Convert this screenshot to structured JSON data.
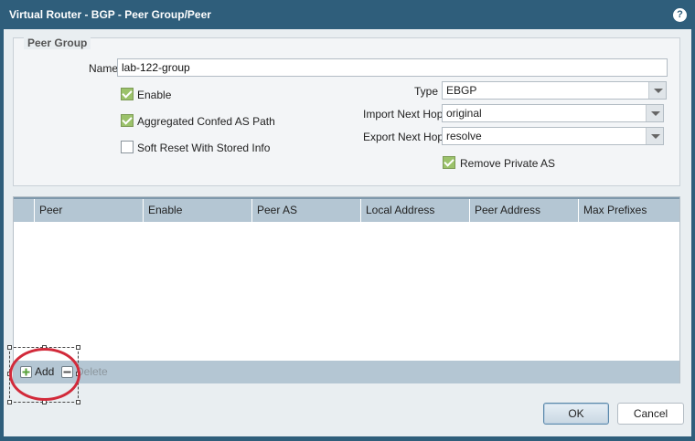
{
  "dialog": {
    "title": "Virtual Router - BGP - Peer Group/Peer",
    "help_icon": "question-icon"
  },
  "peer_group": {
    "legend": "Peer Group",
    "name_label": "Name",
    "name_value": "lab-122-group",
    "enable_label": "Enable",
    "enable_checked": true,
    "aggregated_label": "Aggregated Confed AS Path",
    "aggregated_checked": true,
    "soft_reset_label": "Soft Reset With Stored Info",
    "soft_reset_checked": false,
    "type_label": "Type",
    "type_value": "EBGP",
    "import_label": "Import Next Hop",
    "import_value": "original",
    "export_label": "Export Next Hop",
    "export_value": "resolve",
    "remove_private_label": "Remove Private AS",
    "remove_private_checked": true
  },
  "grid": {
    "columns": [
      "Peer",
      "Enable",
      "Peer AS",
      "Local Address",
      "Peer Address",
      "Max Prefixes"
    ],
    "rows": [],
    "add_label": "Add",
    "delete_label": "Delete"
  },
  "buttons": {
    "ok": "OK",
    "cancel": "Cancel"
  },
  "colors": {
    "titlebar": "#2f5e7b",
    "check_green": "#9bc26a",
    "annotation_circle": "#d22a3a"
  }
}
